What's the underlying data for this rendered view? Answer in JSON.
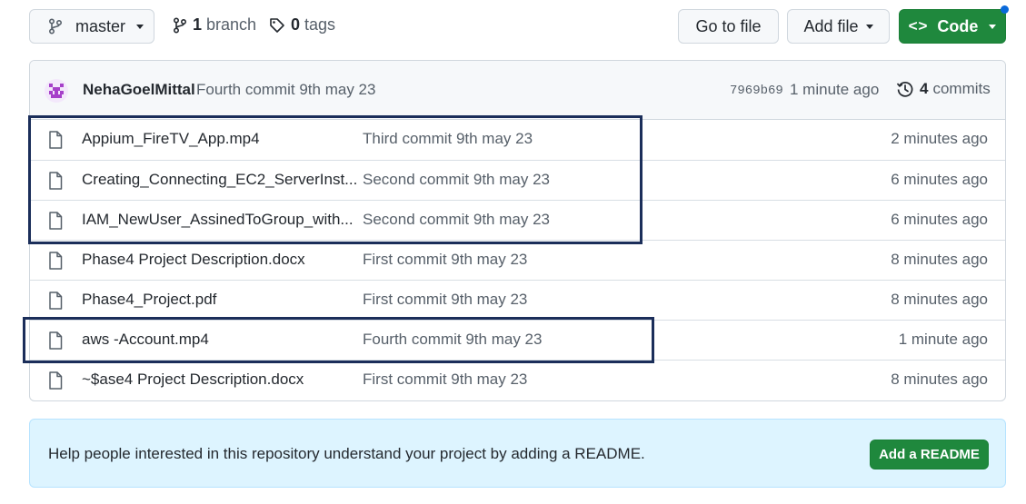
{
  "toolbar": {
    "branch_name": "master",
    "branch_count": "1",
    "branch_label": "branch",
    "tag_count": "0",
    "tag_label": "tags",
    "goto_label": "Go to file",
    "add_file_label": "Add file",
    "code_label": "Code",
    "code_glyph": "<>"
  },
  "latest_commit": {
    "author": "NehaGoelMittal",
    "message": "Fourth commit 9th may 23",
    "hash": "7969b69",
    "time": "1 minute ago",
    "count": "4",
    "count_label": "commits"
  },
  "files": [
    {
      "name": "Appium_FireTV_App.mp4",
      "message": "Third commit 9th may 23",
      "age": "2 minutes ago"
    },
    {
      "name": "Creating_Connecting_EC2_ServerInst...",
      "message": "Second commit 9th may 23",
      "age": "6 minutes ago"
    },
    {
      "name": "IAM_NewUser_AssinedToGroup_with...",
      "message": "Second commit 9th may 23",
      "age": "6 minutes ago"
    },
    {
      "name": "Phase4 Project Description.docx",
      "message": "First commit 9th may 23",
      "age": "8 minutes ago"
    },
    {
      "name": "Phase4_Project.pdf",
      "message": "First commit 9th may 23",
      "age": "8 minutes ago"
    },
    {
      "name": "aws -Account.mp4",
      "message": "Fourth commit 9th may 23",
      "age": "1 minute ago"
    },
    {
      "name": "~$ase4 Project Description.docx",
      "message": "First commit 9th may 23",
      "age": "8 minutes ago"
    }
  ],
  "readme": {
    "text": "Help people interested in this repository understand your project by adding a README.",
    "button_label": "Add a README"
  },
  "colors": {
    "primary_green": "#1f883d",
    "highlight_box": "#1b2e5a",
    "readme_bg": "#ddf4ff",
    "notification_dot": "#0969da"
  }
}
